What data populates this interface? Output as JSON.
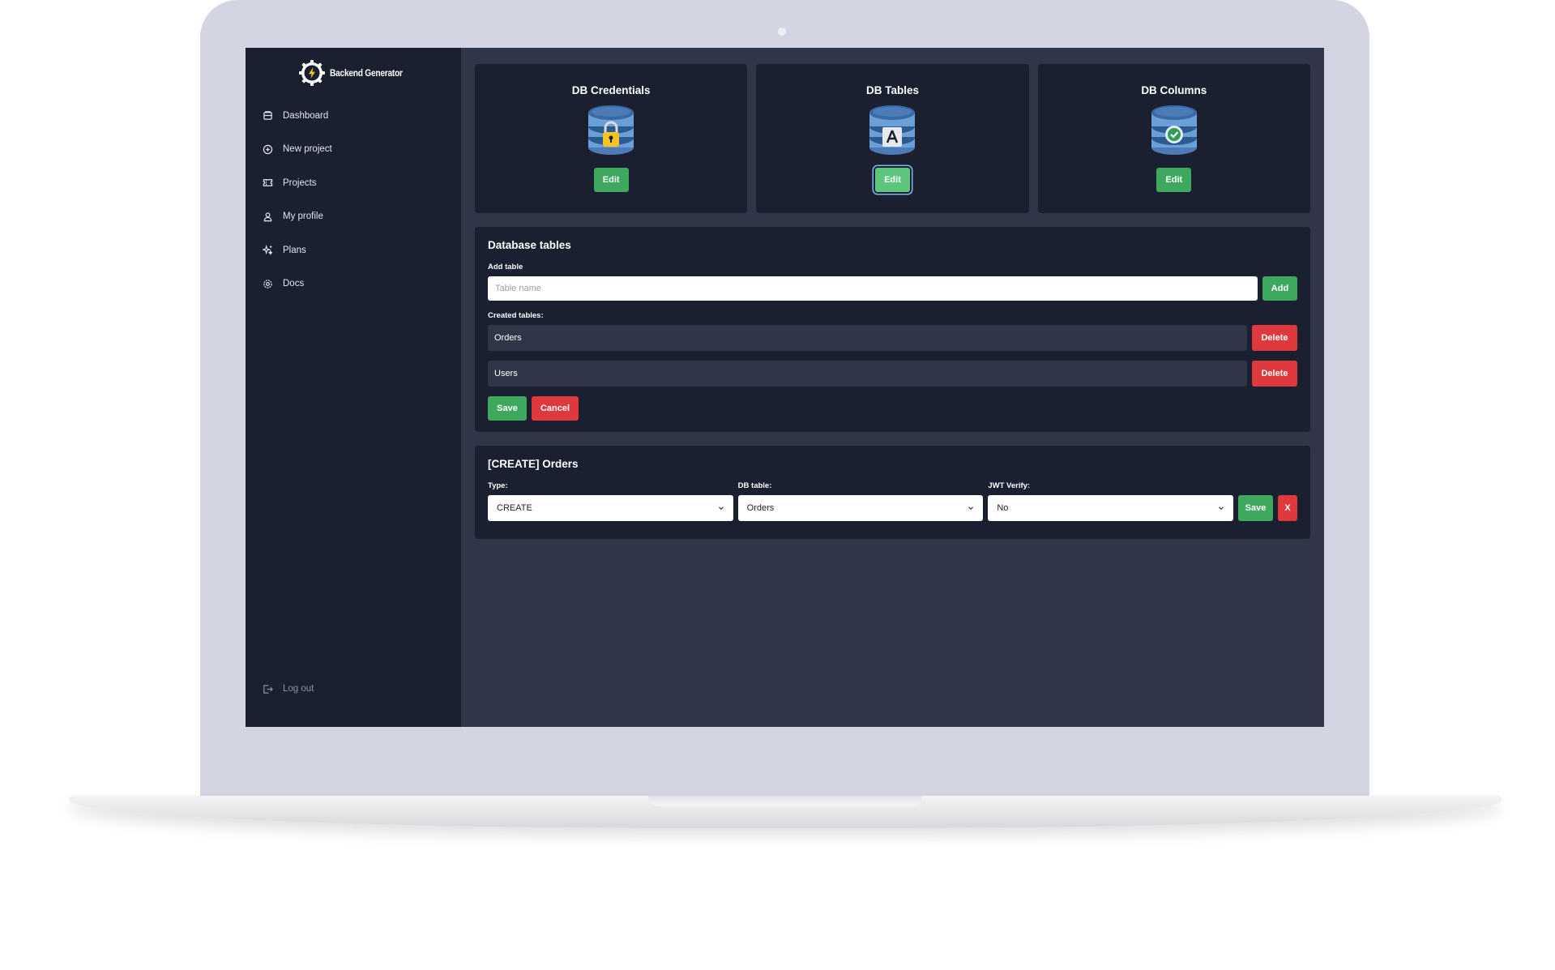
{
  "app": {
    "name": "Backend Generator"
  },
  "sidebar": {
    "items": [
      {
        "label": "Dashboard",
        "icon": "dashboard-icon"
      },
      {
        "label": "New project",
        "icon": "plus-circle-icon"
      },
      {
        "label": "Projects",
        "icon": "ticket-icon"
      },
      {
        "label": "My profile",
        "icon": "user-icon"
      },
      {
        "label": "Plans",
        "icon": "sparkles-icon"
      },
      {
        "label": "Docs",
        "icon": "gear-icon"
      }
    ],
    "logout_label": "Log out"
  },
  "cards": [
    {
      "title": "DB Credentials",
      "button": "Edit",
      "icon": "database-lock-icon"
    },
    {
      "title": "DB Tables",
      "button": "Edit",
      "icon": "database-table-icon"
    },
    {
      "title": "DB Columns",
      "button": "Edit",
      "icon": "database-check-icon"
    }
  ],
  "db_tables": {
    "title": "Database tables",
    "add_label": "Add table",
    "input_placeholder": "Table name",
    "add_button": "Add",
    "created_label": "Created tables:",
    "tables": [
      {
        "name": "Orders",
        "delete": "Delete"
      },
      {
        "name": "Users",
        "delete": "Delete"
      }
    ],
    "save_button": "Save",
    "cancel_button": "Cancel"
  },
  "endpoint": {
    "title": "[CREATE] Orders",
    "type_label": "Type:",
    "type_value": "CREATE",
    "table_label": "DB table:",
    "table_value": "Orders",
    "jwt_label": "JWT Verify:",
    "jwt_value": "No",
    "save_button": "Save",
    "remove_button": "X"
  },
  "colors": {
    "sidebar_bg": "#1b2030",
    "main_bg": "#2f3647",
    "green": "#3fa85f",
    "red": "#e0393d"
  }
}
